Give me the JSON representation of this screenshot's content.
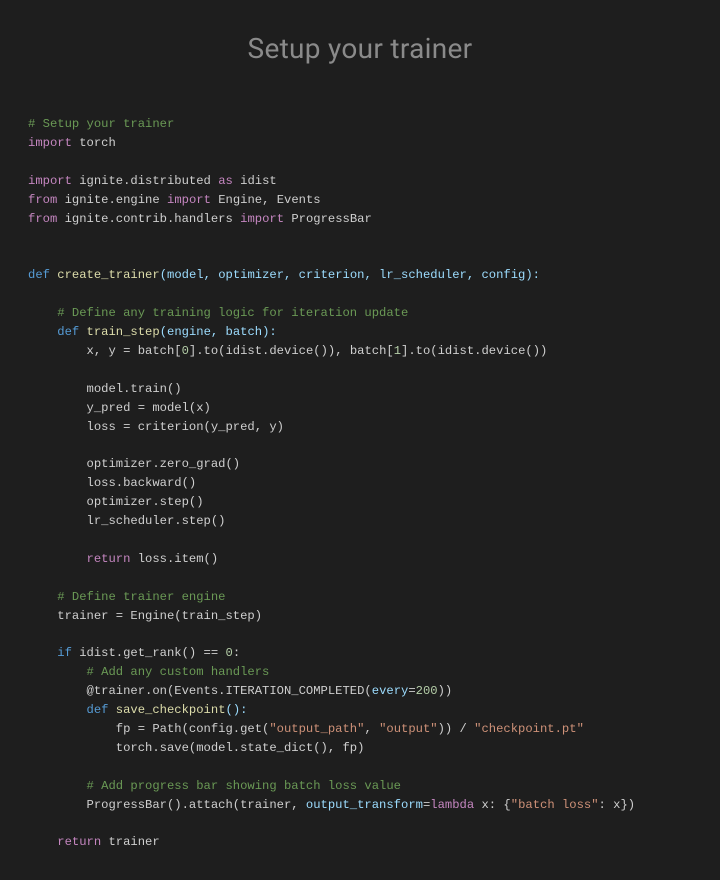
{
  "title": "Setup your trainer",
  "code": {
    "l1": "# Setup your trainer",
    "l2_kw": "import",
    "l2_mod": "torch",
    "l4_kw": "import",
    "l4_mod": "ignite.distributed",
    "l4_as": "as",
    "l4_alias": "idist",
    "l5_from": "from",
    "l5_mod": "ignite.engine",
    "l5_import": "import",
    "l5_names": "Engine, Events",
    "l6_from": "from",
    "l6_mod": "ignite.contrib.handlers",
    "l6_import": "import",
    "l6_name": "ProgressBar",
    "l9_def": "def",
    "l9_fn": "create_trainer",
    "l9_params": "(model, optimizer, criterion, lr_scheduler, config):",
    "l11": "    # Define any training logic for iteration update",
    "l12_def": "def",
    "l12_fn": "train_step",
    "l12_params": "(engine, batch):",
    "l13": "        x, y = batch[",
    "l13_n0": "0",
    "l13_mid": "].to(idist.device()), batch[",
    "l13_n1": "1",
    "l13_end": "].to(idist.device())",
    "l15": "        model.train()",
    "l16": "        y_pred = model(x)",
    "l17": "        loss = criterion(y_pred, y)",
    "l19": "        optimizer.zero_grad()",
    "l20": "        loss.backward()",
    "l21": "        optimizer.step()",
    "l22": "        lr_scheduler.step()",
    "l24_kw": "return",
    "l24_expr": " loss.item()",
    "l26": "    # Define trainer engine",
    "l27": "    trainer = Engine(train_step)",
    "l29_if": "if",
    "l29_expr": " idist.get_rank() == ",
    "l29_n": "0",
    "l29_end": ":",
    "l30": "        # Add any custom handlers",
    "l31_pre": "        @trainer.on(Events.ITERATION_COMPLETED(",
    "l31_kw": "every",
    "l31_eq": "=",
    "l31_n": "200",
    "l31_end": "))",
    "l32_def": "def",
    "l32_fn": "save_checkpoint",
    "l32_params": "():",
    "l33_pre": "            fp = Path(config.get(",
    "l33_s1": "\"output_path\"",
    "l33_comma": ", ",
    "l33_s2": "\"output\"",
    "l33_mid": ")) / ",
    "l33_s3": "\"checkpoint.pt\"",
    "l34": "            torch.save(model.state_dict(), fp)",
    "l36": "        # Add progress bar showing batch loss value",
    "l37_pre": "        ProgressBar().attach(trainer, ",
    "l37_kw": "output_transform",
    "l37_eq": "=",
    "l37_lambda": "lambda",
    "l37_x": " x: {",
    "l37_s": "\"batch loss\"",
    "l37_end": ": x})",
    "l39_kw": "return",
    "l39_expr": " trainer"
  }
}
